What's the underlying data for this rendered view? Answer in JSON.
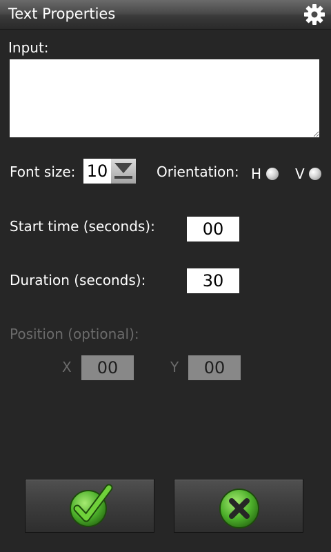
{
  "header": {
    "title": "Text Properties",
    "settings_icon": "gear-icon"
  },
  "form": {
    "input_label": "Input:",
    "input_value": "",
    "font_size_label": "Font size:",
    "font_size_value": "10",
    "orientation_label": "Orientation:",
    "orientation_h": "H",
    "orientation_v": "V",
    "start_time_label": "Start time (seconds):",
    "start_time_value": "00",
    "duration_label": "Duration (seconds):",
    "duration_value": "30",
    "position_label": "Position (optional):",
    "x_label": "X",
    "x_value": "00",
    "y_label": "Y",
    "y_value": "00"
  },
  "actions": {
    "confirm_icon": "checkmark-icon",
    "cancel_icon": "close-icon"
  },
  "colors": {
    "background": "#262626",
    "accent_green": "#4caf2a",
    "disabled_field": "#888888",
    "disabled_text": "#6b6b6b"
  }
}
